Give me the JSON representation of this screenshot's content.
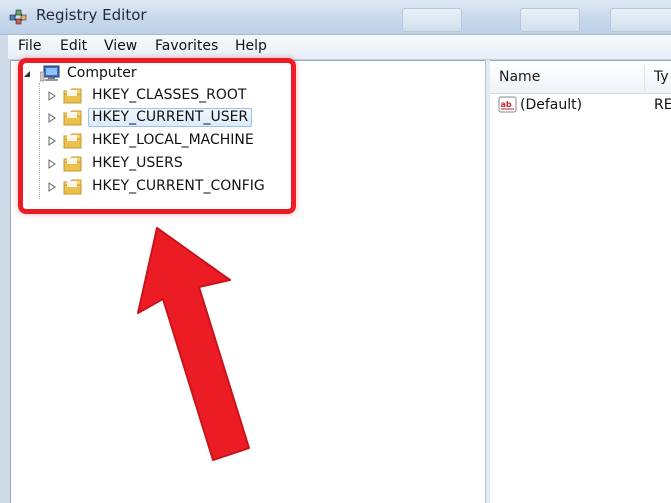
{
  "window": {
    "title": "Registry Editor",
    "app_icon": "registry-editor-icon"
  },
  "menu": {
    "items": [
      "File",
      "Edit",
      "View",
      "Favorites",
      "Help"
    ]
  },
  "tree": {
    "root": {
      "label": "Computer",
      "icon": "computer-icon"
    },
    "children": [
      {
        "label": "HKEY_CLASSES_ROOT",
        "icon": "folder-icon",
        "selected": false
      },
      {
        "label": "HKEY_CURRENT_USER",
        "icon": "folder-icon",
        "selected": true
      },
      {
        "label": "HKEY_LOCAL_MACHINE",
        "icon": "folder-icon",
        "selected": false
      },
      {
        "label": "HKEY_USERS",
        "icon": "folder-icon",
        "selected": false
      },
      {
        "label": "HKEY_CURRENT_CONFIG",
        "icon": "folder-icon",
        "selected": false
      }
    ]
  },
  "values_list": {
    "columns": [
      "Name",
      "Ty"
    ],
    "rows": [
      {
        "icon": "string-value-icon",
        "name": "(Default)",
        "type": "RE"
      }
    ]
  },
  "annotation": {
    "highlight_color": "#ec1c24",
    "arrow_color": "#ec1c24"
  },
  "colors": {
    "selection_fill": "#dbeafb",
    "selection_border": "#99c2ec",
    "folder": "#e8c25a"
  }
}
